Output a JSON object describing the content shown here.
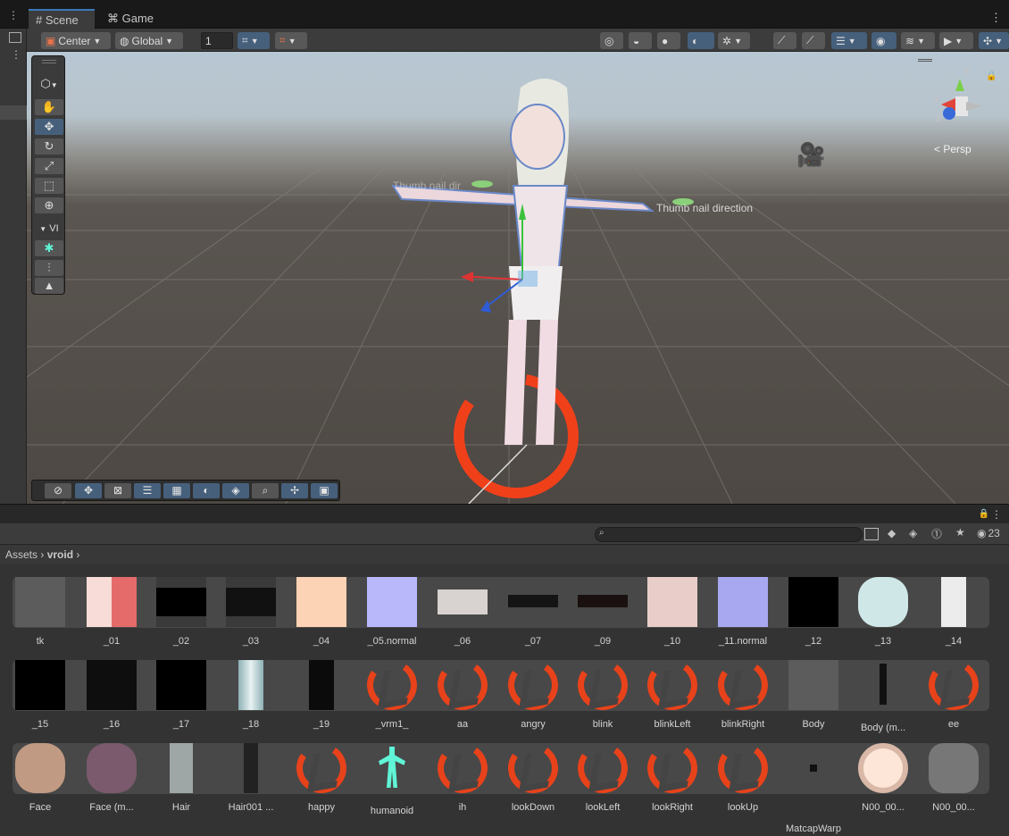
{
  "tabs": [
    {
      "label": "Scene",
      "icon": "grid-icon",
      "active": true
    },
    {
      "label": "Game",
      "icon": "gamepad-icon",
      "active": false
    }
  ],
  "toolbar": {
    "pivot": "Center",
    "space": "Global",
    "grid_snap_value": "1"
  },
  "tools_panel": {
    "vi_label": "VI"
  },
  "viewport": {
    "persp_label": "Persp",
    "axis_y": "y",
    "axis_x": "x",
    "axis_z": "z",
    "label_thumb": "Thumb nail direction",
    "label_thumb_left": "Thumb nail dir"
  },
  "project": {
    "search_placeholder": "",
    "hidden_count": "23",
    "breadcrumb": [
      "Assets",
      "vroid"
    ]
  },
  "assets": {
    "row1": [
      "tk",
      "_01",
      "_02",
      "_03",
      "_04",
      "_05.normal",
      "_06",
      "_07",
      "_09",
      "_10",
      "_11.normal",
      "_12",
      "_13",
      "_14"
    ],
    "row2": [
      "_15",
      "_16",
      "_17",
      "_18",
      "_19",
      "_vrm1_",
      "aa",
      "angry",
      "blink",
      "blinkLeft",
      "blinkRight",
      "Body",
      "Body (m...",
      "ee"
    ],
    "row3": [
      "Face",
      "Face (m...",
      "Hair",
      "Hair001 ...",
      "happy",
      "humanoid",
      "ih",
      "lookDown",
      "lookLeft",
      "lookRight",
      "lookUp",
      "MatcapWarp",
      "N00_00...",
      "N00_00..."
    ]
  },
  "colors": {
    "accent": "#46607c",
    "vrm_orange": "#e8421b",
    "humanoid": "#5ff5d6"
  }
}
